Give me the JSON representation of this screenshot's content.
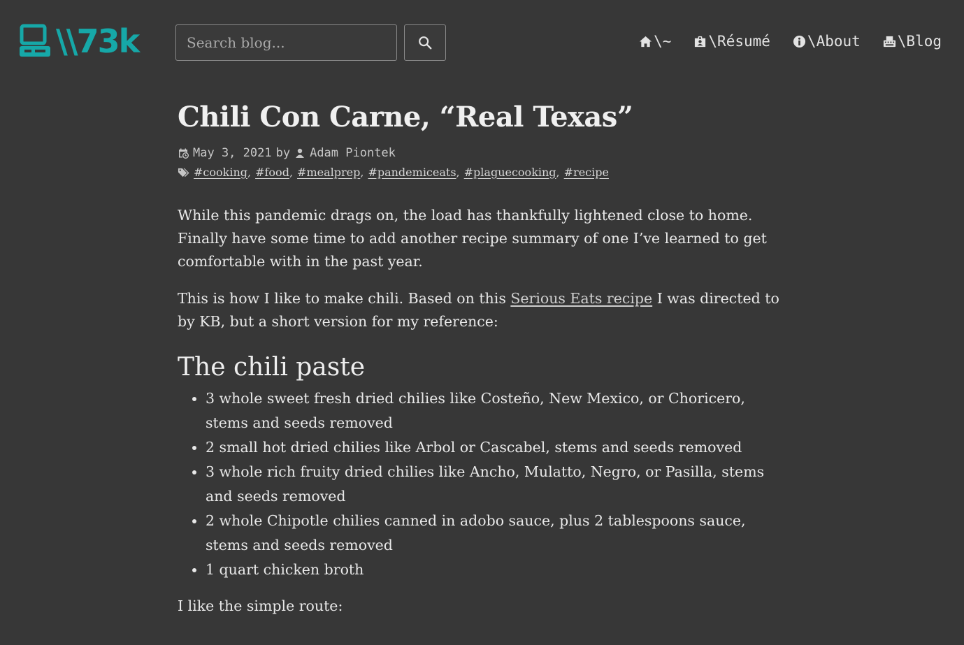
{
  "header": {
    "logo_text": "\\\\73k",
    "search": {
      "placeholder": "Search blog..."
    },
    "nav": [
      {
        "icon": "home-icon",
        "label": "\\~"
      },
      {
        "icon": "id-badge-icon",
        "label": "\\Résumé"
      },
      {
        "icon": "info-circle-icon",
        "label": "\\About"
      },
      {
        "icon": "typewriter-icon",
        "label": "\\Blog"
      }
    ]
  },
  "colors": {
    "background": "#373737",
    "brand": "#16a8a8",
    "text": "#e8e8e8"
  },
  "post": {
    "title": "Chili Con Carne, “Real Texas”",
    "date": "May 3, 2021",
    "by": "by",
    "author": "Adam Piontek",
    "tags": [
      "#cooking",
      "#food",
      "#mealprep",
      "#pandemiceats",
      "#plaguecooking",
      "#recipe"
    ],
    "intro": "While this pandemic drags on, the load has thankfully lightened close to home. Finally have some time to add another recipe summary of one I’ve learned to get comfortable with in the past year.",
    "p2_before": "This is how I like to make chili. Based on this ",
    "p2_link": "Serious Eats recipe",
    "p2_after": " I was directed to by KB, but a short version for my reference:",
    "section_heading": "The chili paste",
    "ingredients": [
      "3 whole sweet fresh dried chilies like Costeño, New Mexico, or Choricero, stems and seeds removed",
      "2 small hot dried chilies like Arbol or Cascabel, stems and seeds removed",
      "3 whole rich fruity dried chilies like Ancho, Mulatto, Negro, or Pasilla, stems and seeds removed",
      "2 whole Chipotle chilies canned in adobo sauce, plus 2 tablespoons sauce, stems and seeds removed",
      "1 quart chicken broth"
    ],
    "p3": "I like the simple route:"
  }
}
